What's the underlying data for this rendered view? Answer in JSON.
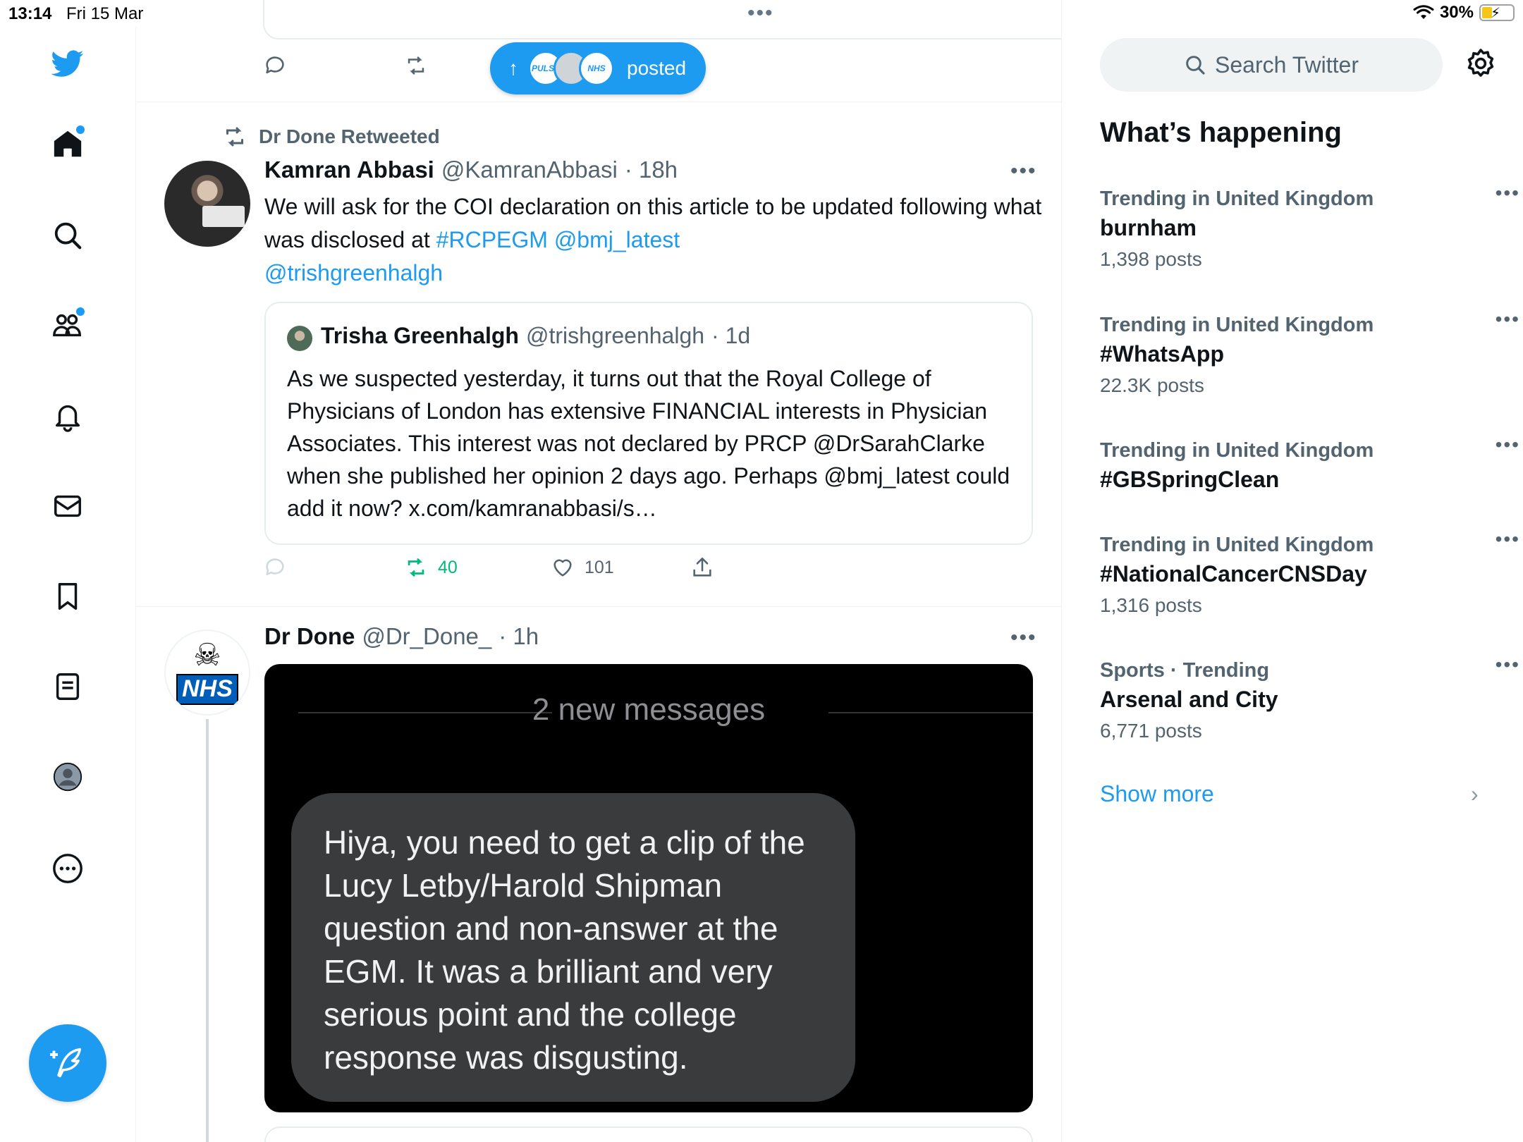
{
  "status_bar": {
    "time": "13:14",
    "date": "Fri 15 Mar",
    "battery": "30%"
  },
  "nav": {
    "items": [
      "home",
      "explore",
      "communities",
      "notifications",
      "messages",
      "bookmarks",
      "lists",
      "profile",
      "more"
    ]
  },
  "top_tweet_actions": {
    "posted_pill_label": "posted",
    "pill_avatar_1": "PULSE",
    "pill_avatar_2": "NHS"
  },
  "retweet_tweet": {
    "retweeted_by": "Dr Done Retweeted",
    "author_name": "Kamran Abbasi",
    "author_handle": "@KamranAbbasi",
    "time": "· 18h",
    "text_part1": "We will ask for the COI declaration on this article to be updated following what was disclosed at ",
    "link1": "#RCPEGM",
    "link2": "@bmj_latest",
    "link3": "@trishgreenhalgh",
    "quote": {
      "author_name": "Trisha Greenhalgh",
      "author_handle": "@trishgreenhalgh",
      "time": "· 1d",
      "text": "As we suspected yesterday, it turns out that the Royal College of Physicians of London has extensive FINANCIAL interests in Physician Associates. This interest was not declared by PRCP @DrSarahClarke when she published her opinion 2 days ago. Perhaps @bmj_latest could add it now? x.com/kamranabbasi/s…"
    },
    "retweet_count": "40",
    "like_count": "101"
  },
  "drdone_tweet": {
    "author_name": "Dr Done",
    "author_handle": "@Dr_Done_",
    "time": "· 1h",
    "avatar_text": "NHS",
    "image": {
      "new_messages": "2 new messages",
      "bubble_text": "Hiya, you need to get a clip of the Lucy Letby/Harold Shipman question and non-answer at the EGM. It was a brilliant and very serious point and the college response was disgusting."
    }
  },
  "sidebar": {
    "search_placeholder": "Search Twitter",
    "heading": "What’s happening",
    "trends": [
      {
        "context": "Trending in United Kingdom",
        "name": "burnham",
        "count": "1,398 posts"
      },
      {
        "context": "Trending in United Kingdom",
        "name": "#WhatsApp",
        "count": "22.3K posts"
      },
      {
        "context": "Trending in United Kingdom",
        "name": "#GBSpringClean",
        "count": ""
      },
      {
        "context": "Trending in United Kingdom",
        "name": "#NationalCancerCNSDay",
        "count": "1,316 posts"
      },
      {
        "context": "Sports · Trending",
        "name": "Arsenal and City",
        "count": "6,771 posts"
      }
    ],
    "show_more": "Show more"
  },
  "colors": {
    "accent": "#1d9bf0",
    "retweet_green": "#00ba7c",
    "muted": "#536471"
  }
}
